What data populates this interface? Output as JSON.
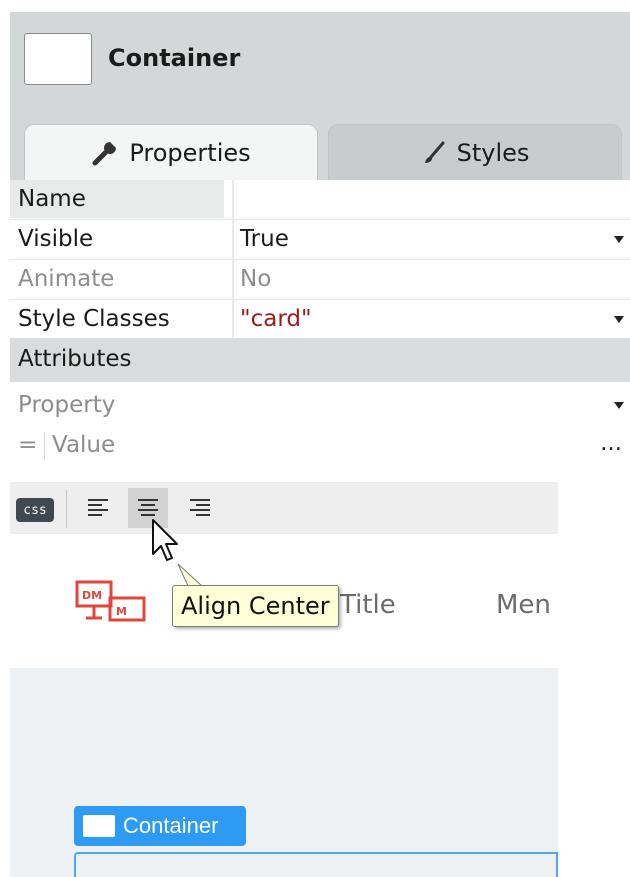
{
  "header": {
    "title": "Container"
  },
  "tabs": [
    {
      "label": "Properties",
      "icon": "wrench-icon",
      "active": true
    },
    {
      "label": "Styles",
      "icon": "brush-icon",
      "active": false
    }
  ],
  "properties": {
    "name": {
      "label": "Name",
      "value": ""
    },
    "visible": {
      "label": "Visible",
      "value": "True"
    },
    "animate": {
      "label": "Animate",
      "value": "No"
    },
    "style_classes": {
      "label": "Style Classes",
      "value": "\"card\""
    }
  },
  "attributes": {
    "header": "Attributes",
    "property_placeholder": "Property",
    "equals": "=",
    "value_placeholder": "Value",
    "more": "..."
  },
  "toolbar": {
    "css_label": "css",
    "buttons": [
      "align-left-icon",
      "align-center-icon",
      "align-right-icon"
    ],
    "hovered": "align-center-icon"
  },
  "tooltip": {
    "text": "Align Center"
  },
  "canvas": {
    "title": "Title",
    "menu": "Men",
    "container_label": "Container"
  },
  "colors": {
    "accent": "#2d9af4",
    "string_value": "#9b1b1b",
    "tooltip_bg": "#ffffd8"
  }
}
